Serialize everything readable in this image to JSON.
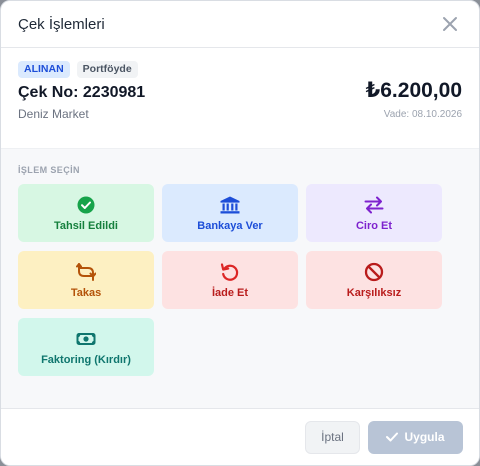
{
  "modal": {
    "title": "Çek İşlemleri",
    "close_icon": "close-icon"
  },
  "check": {
    "status_badge": "ALINAN",
    "location_badge": "Portföyde",
    "number": "Çek No: 2230981",
    "customer": "Deniz Market",
    "amount": "₺6.200,00",
    "due": "Vade: 08.10.2026"
  },
  "actions": {
    "section_label": "İŞLEM SEÇİN",
    "items": [
      {
        "label": "Tahsil Edildi",
        "icon": "check-circle-icon",
        "color": "#16a34a"
      },
      {
        "label": "Bankaya Ver",
        "icon": "bank-icon",
        "color": "#1d4ed8"
      },
      {
        "label": "Ciro Et",
        "icon": "arrows-exchange-icon",
        "color": "#7e22ce"
      },
      {
        "label": "Takas",
        "icon": "repeat-icon",
        "color": "#b45309"
      },
      {
        "label": "İade Et",
        "icon": "undo-icon",
        "color": "#dc2626"
      },
      {
        "label": "Karşılıksız",
        "icon": "ban-icon",
        "color": "#b91c1c"
      },
      {
        "label": "Faktoring (Kırdır)",
        "icon": "money-bill-icon",
        "color": "#0f766e"
      }
    ]
  },
  "footer": {
    "cancel_label": "İptal",
    "apply_label": "Uygula"
  }
}
